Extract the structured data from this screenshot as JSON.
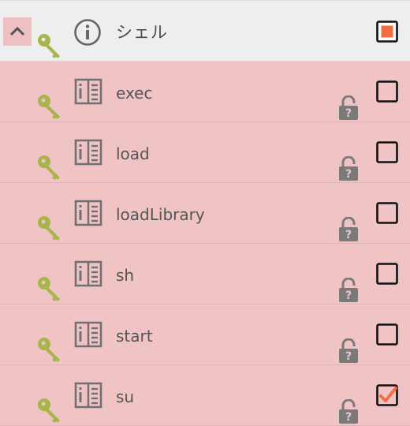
{
  "group": {
    "label": "シェル",
    "expanded": true,
    "checkbox_state": "partial",
    "icons": [
      "chevron-up-icon",
      "key-icon",
      "info-icon"
    ]
  },
  "permissions": [
    {
      "label": "exec",
      "checked": false,
      "locked": true
    },
    {
      "label": "load",
      "checked": false,
      "locked": true
    },
    {
      "label": "loadLibrary",
      "checked": false,
      "locked": true
    },
    {
      "label": "sh",
      "checked": false,
      "locked": true
    },
    {
      "label": "start",
      "checked": false,
      "locked": true
    },
    {
      "label": "su",
      "checked": true,
      "locked": true
    }
  ],
  "colors": {
    "row_background": "#f0c3c5",
    "group_background": "#eeeeee",
    "key_icon": "#a8b54a",
    "accent": "#f26f43"
  }
}
